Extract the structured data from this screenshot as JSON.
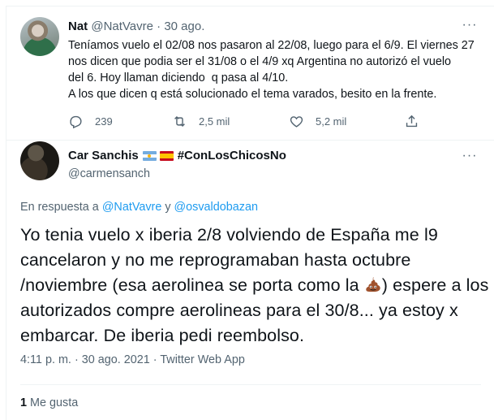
{
  "tweet1": {
    "name": "Nat",
    "handle": "@NatVavre",
    "dot": "·",
    "date": "30 ago.",
    "more_icon": "more-dots-icon",
    "text_lines": [
      "Teníamos vuelo el 02/08 nos pasaron al 22/08, luego para el 6/9. El viernes 27",
      "nos dicen que podia ser el 31/08 o el 4/9 xq Argentina no autorizó el vuelo",
      "del 6. Hoy llaman diciendo  q pasa al 4/10.",
      "A los que dicen q está solucionado el tema varados, besito en la frente."
    ],
    "replies": "239",
    "retweets": "2,5 mil",
    "likes": "5,2 mil"
  },
  "tweet2": {
    "name": "Car Sanchis",
    "hashtag": "#ConLosChicosNo",
    "handle": "@carmensanch",
    "reply_prefix": "En respuesta a",
    "reply_user1": "@NatVavre",
    "reply_and": "y",
    "reply_user2": "@osvaldobazan",
    "text_part1": "Yo tenia vuelo x iberia 2/8 volviendo de España me l9 cancelaron y no me reprogramaban hasta octubre /noviembre (esa aerolinea se porta como la ",
    "text_part2": ") espere a los autorizados compre aerolineas para el 30/8... ya estoy x embarcar. De iberia pedi reembolso.",
    "time": "4:11 p. m.",
    "dot": "·",
    "date": "30 ago. 2021",
    "source": "Twitter Web App",
    "like_count": "1",
    "like_label": "Me gusta"
  },
  "colors": {
    "text": "#0f1419",
    "muted": "#536471",
    "link": "#1d9bf0",
    "border": "#eff3f4"
  }
}
